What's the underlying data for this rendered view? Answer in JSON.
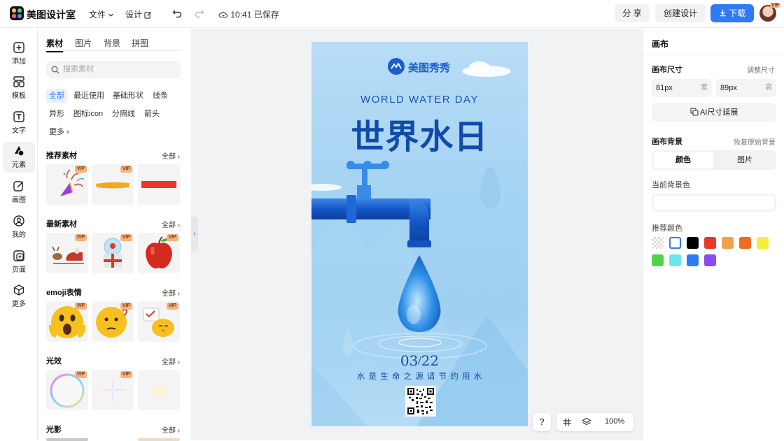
{
  "app": {
    "name": "美图设计室"
  },
  "topbar": {
    "file_menu": "文件",
    "design_menu": "设计",
    "saved_status": "10:41 已保存",
    "share_label": "分 享",
    "create_label": "创建设计",
    "download_label": "下载",
    "avatar_badge": "VIP"
  },
  "rail": {
    "items": [
      {
        "label": "添加",
        "icon": "plus-square-icon"
      },
      {
        "label": "模板",
        "icon": "template-icon"
      },
      {
        "label": "文字",
        "icon": "text-icon"
      },
      {
        "label": "元素",
        "icon": "shapes-icon"
      },
      {
        "label": "画图",
        "icon": "draw-icon"
      },
      {
        "label": "我的",
        "icon": "user-icon"
      },
      {
        "label": "页面",
        "icon": "page-icon"
      },
      {
        "label": "更多",
        "icon": "cube-icon"
      }
    ],
    "active_index": 3
  },
  "panel": {
    "tabs": [
      "素材",
      "图片",
      "背景",
      "拼图"
    ],
    "search_placeholder": "搜索素材",
    "chips": [
      "全部",
      "最近使用",
      "基础形状",
      "线条",
      "异形",
      "图标icon",
      "分隔线",
      "箭头",
      "更多"
    ],
    "sections": [
      {
        "title": "推荐素材",
        "all": "全部"
      },
      {
        "title": "最新素材",
        "all": "全部"
      },
      {
        "title": "emoji表情",
        "all": "全部"
      },
      {
        "title": "光效",
        "all": "全部"
      },
      {
        "title": "光影",
        "all": "全部"
      }
    ],
    "vip_badge": "VIP"
  },
  "poster": {
    "brand": "美图秀秀",
    "subtitle_en": "WORLD WATER DAY",
    "title": "世界水日",
    "date_month": "03",
    "date_day": "22",
    "slogan": "水 是 生 命 之 源 请 节 约 用 水"
  },
  "zoom": {
    "help": "?",
    "level": "100%"
  },
  "right_panel": {
    "title": "画布",
    "size_label": "画布尺寸",
    "adjust_link": "调整尺寸",
    "width_value": "81px",
    "width_suffix": "宽",
    "height_value": "89px",
    "height_suffix": "高",
    "ai_extend": "AI尺寸延展",
    "bg_label": "画布背景",
    "restore_link": "恢复原始背景",
    "bg_tabs": [
      "颜色",
      "图片"
    ],
    "current_bg_label": "当前背景色",
    "recommended_label": "推荐颜色",
    "colors": [
      "transparent",
      "#ffffff",
      "#000000",
      "#e8382c",
      "#f0a24a",
      "#ee6c1f",
      "#f6ee3b",
      "#55d24b",
      "#6be7ec",
      "#2f7bf5",
      "#8a4bf3"
    ]
  }
}
